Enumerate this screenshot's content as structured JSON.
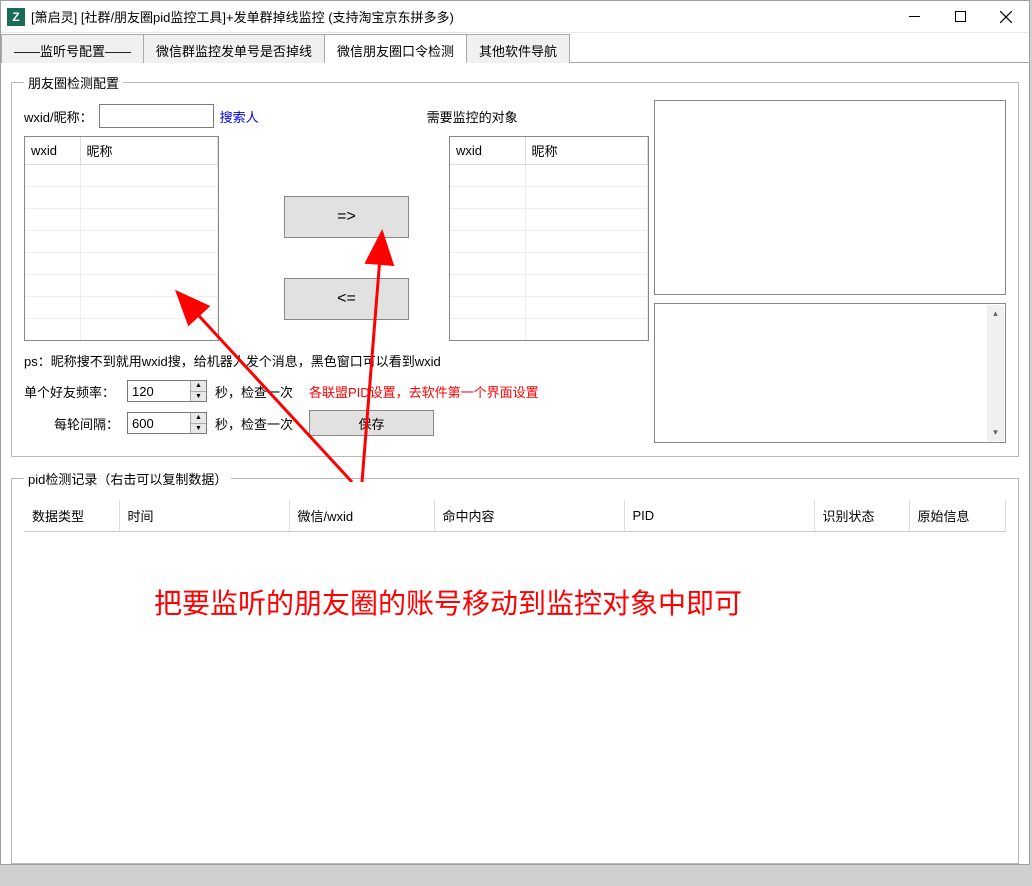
{
  "window": {
    "title": "[箫启灵] [社群/朋友圈pid监控工具]+发单群掉线监控 (支持淘宝京东拼多多)"
  },
  "tabs": {
    "t0": "——监听号配置——",
    "t1": "微信群监控发单号是否掉线",
    "t2": "微信朋友圈口令检测",
    "t3": "其他软件导航"
  },
  "config": {
    "legend": "朋友圈检测配置",
    "wxid_label": "wxid/昵称：",
    "search_link": "搜索人",
    "target_label": "需要监控的对象",
    "col_wxid": "wxid",
    "col_nick": "昵称",
    "arrow_right": "=>",
    "arrow_left": "<=",
    "ps_text": "ps：昵称搜不到就用wxid搜，给机器人发个消息，黑色窗口可以看到wxid",
    "freq_label": "单个好友频率：",
    "freq_value": "120",
    "freq_unit": "秒，检查一次",
    "pid_note": "各联盟PID设置，去软件第一个界面设置",
    "interval_label": "每轮间隔：",
    "interval_value": "600",
    "interval_unit": "秒，检查一次",
    "save_btn": "保存"
  },
  "records": {
    "legend": "pid检测记录（右击可以复制数据）",
    "cols": {
      "c0": "数据类型",
      "c1": "时间",
      "c2": "微信/wxid",
      "c3": "命中内容",
      "c4": "PID",
      "c5": "识别状态",
      "c6": "原始信息"
    },
    "annotation": "把要监听的朋友圈的账号移动到监控对象中即可"
  }
}
